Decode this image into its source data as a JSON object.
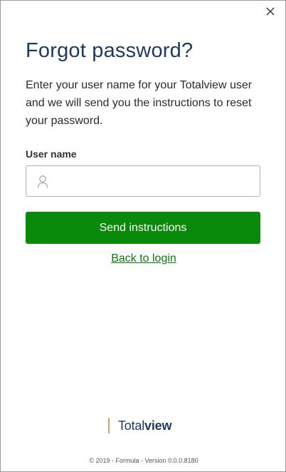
{
  "window": {
    "close_icon": "close-icon"
  },
  "main": {
    "title": "Forgot password?",
    "description": "Enter your user name for your Totalview user and we will send you the instructions to reset your password.",
    "username_label": "User name",
    "username_value": "",
    "username_placeholder": "",
    "username_icon": "user-icon",
    "send_button_label": "Send instructions",
    "back_link_label": "Back to login"
  },
  "branding": {
    "logo_light": "Total",
    "logo_bold": "view"
  },
  "footer": {
    "text": "© 2019 - Formula - Version 0.0.0.8180"
  },
  "colors": {
    "accent_green": "#0a8a0a",
    "title_navy": "#1f3a5f",
    "input_border": "#9bb8d3",
    "logo_bar": "#c7a46a"
  }
}
